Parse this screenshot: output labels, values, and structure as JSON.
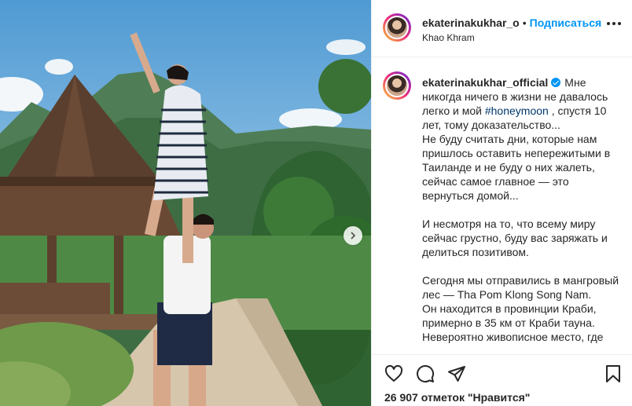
{
  "post": {
    "username": "ekaterinakukhar_official",
    "username_header": "ekaterinakukhar_o",
    "separator": "•",
    "follow_label": "Подписаться",
    "location": "Khao Khram"
  },
  "caption": {
    "text_before": "Мне никогда ничего в жизни не давалось легко и мой ",
    "hashtag": "#honeymoon",
    "text_after": " , спустя 10 лет, тому доказательство...\nНе буду считать дни, которые нам пришлось оставить непережитыми в Таиланде и не буду о них жалеть, сейчас самое главное — это вернуться домой...\n\nИ несмотря на то, что всему миру сейчас грустно, буду вас заряжать и делиться позитивом.\n\nСегодня мы отправились в мангровый лес — Tha Pom Klong Song Nam.\nОн находится в провинции Краби, примерно в 35 км от Краби тауна.\nНевероятно живописное место, где"
  },
  "likes_text": "26 907 отметок \"Нравится\"",
  "icons": [
    "heart-icon",
    "comment-icon",
    "share-icon",
    "bookmark-icon",
    "more-icon",
    "chevron-right-icon",
    "verified-icon"
  ],
  "colors": {
    "accent": "#0095f6",
    "hashtag": "#00376b",
    "text": "#262626",
    "border": "#efefef"
  }
}
